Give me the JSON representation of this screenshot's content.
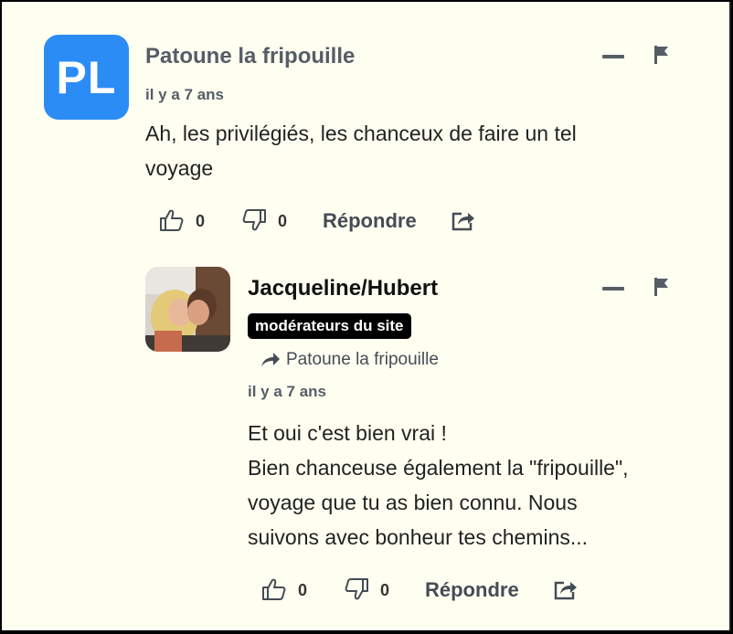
{
  "comment": {
    "avatar_initials": "PL",
    "author": "Patoune la fripouille",
    "time": "il y a 7 ans",
    "text_line1": "Ah, les privilégiés, les chanceux de faire un tel",
    "text_line2": "voyage",
    "likes": "0",
    "dislikes": "0",
    "reply_label": "Répondre"
  },
  "reply": {
    "author": "Jacqueline/Hubert",
    "badge": "modérateurs du site",
    "reply_to": "Patoune la fripouille",
    "time": "il y a 7 ans",
    "text_line1": "Et oui c'est bien vrai !",
    "text_line2": "Bien chanceuse également la \"fripouille\",",
    "text_line3": "voyage que tu as bien connu. Nous",
    "text_line4": "suivons avec bonheur tes chemins...",
    "likes": "0",
    "dislikes": "0",
    "reply_label": "Répondre"
  },
  "colors": {
    "background": "#fffff1",
    "avatar": "#2b8cf6",
    "meta": "#555d66",
    "badge": "#000000"
  },
  "icons": [
    "minus-icon",
    "flag-icon",
    "thumbs-up-icon",
    "thumbs-down-icon",
    "share-icon",
    "reply-arrow-icon"
  ]
}
